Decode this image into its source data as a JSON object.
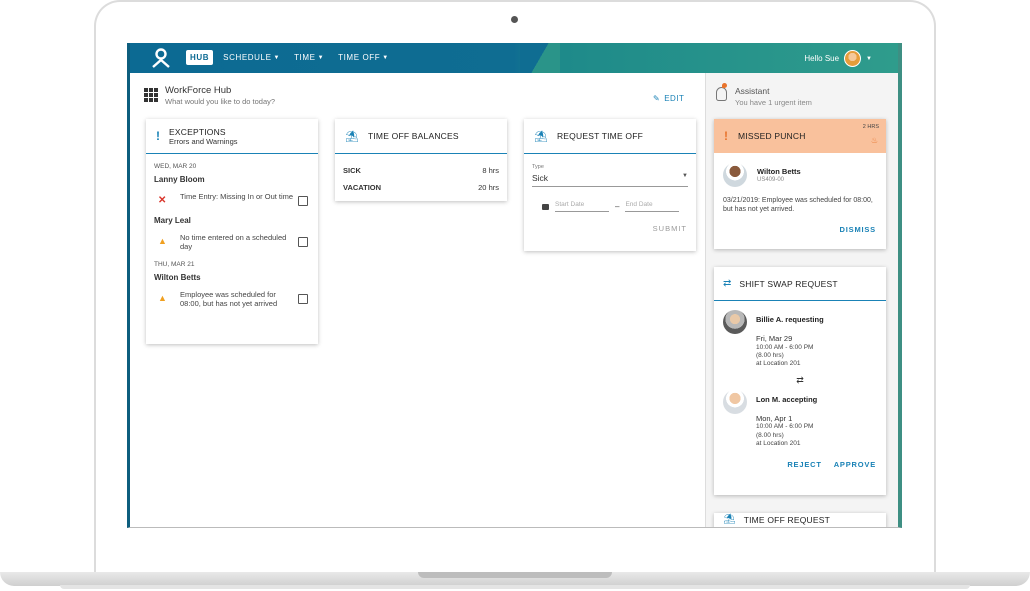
{
  "nav": {
    "hub": "HUB",
    "schedule": "SCHEDULE",
    "time": "TIME",
    "timeoff": "TIME OFF",
    "greeting": "Hello Sue"
  },
  "hub": {
    "title": "WorkForce Hub",
    "subtitle": "What would you like to do today?",
    "edit": "EDIT"
  },
  "exceptions": {
    "title": "EXCEPTIONS",
    "subtitle": "Errors and Warnings",
    "groups": [
      {
        "date": "WED, MAR 20"
      },
      {
        "date": "THU, MAR 21"
      }
    ],
    "people": [
      "Lanny Bloom",
      "Mary Leal",
      "Wilton Betts"
    ],
    "items": [
      "Time Entry: Missing In or Out time",
      "No time entered on a scheduled day",
      "Employee was scheduled for 08:00, but has not yet arrived"
    ]
  },
  "balances": {
    "title": "TIME OFF BALANCES",
    "rows": [
      {
        "label": "SICK",
        "value": "8 hrs"
      },
      {
        "label": "VACATION",
        "value": "20 hrs"
      }
    ]
  },
  "request": {
    "title": "REQUEST TIME OFF",
    "type_label": "Type",
    "type_value": "Sick",
    "start_placeholder": "Start Date",
    "end_placeholder": "End Date",
    "submit": "SUBMIT"
  },
  "assistant": {
    "title": "Assistant",
    "subtitle": "You have 1 urgent item"
  },
  "missed": {
    "title": "MISSED PUNCH",
    "badge": "2 HRS",
    "name": "Wilton Betts",
    "id": "US409-00",
    "text": "03/21/2019: Employee was scheduled for 08:00, but has not yet arrived.",
    "dismiss": "DISMISS"
  },
  "swap": {
    "title": "SHIFT SWAP REQUEST",
    "requester": {
      "name": "Billie A. requesting",
      "day": "Fri, Mar 29",
      "time": "10:00 AM - 6:00 PM",
      "hours": "(8.00 hrs)",
      "location": "at Location 201"
    },
    "accepter": {
      "name": "Lon M. accepting",
      "day": "Mon, Apr 1",
      "time": "10:00 AM - 6:00 PM",
      "hours": "(8.00 hrs)",
      "location": "at Location 201"
    },
    "reject": "REJECT",
    "approve": "APPROVE"
  },
  "timeoff_request": {
    "title": "TIME OFF REQUEST"
  }
}
